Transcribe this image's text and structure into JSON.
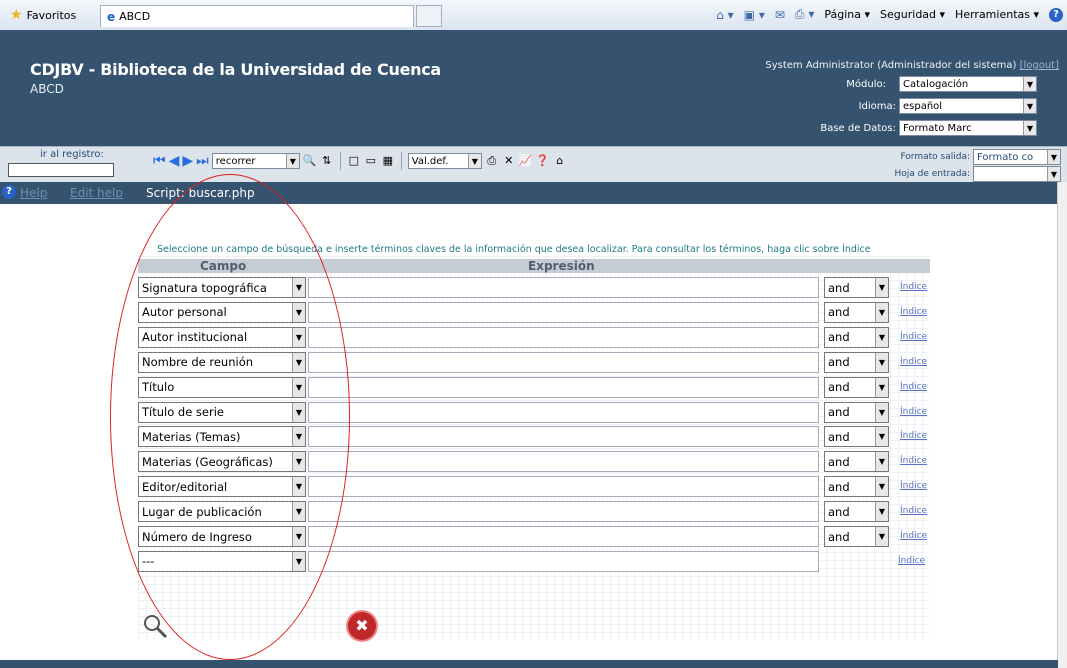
{
  "browser": {
    "favorites_label": "Favoritos",
    "tab_title": "ABCD",
    "commands": [
      "Página ▾",
      "Seguridad ▾",
      "Herramientas ▾"
    ]
  },
  "header": {
    "title": "CDJBV - Biblioteca de la Universidad de Cuenca",
    "subtitle": "ABCD",
    "user_text": "System Administrator (Administrador del sistema)",
    "logout_label": "[logout]",
    "modulo_label": "Módulo:",
    "modulo_value": "Catalogación",
    "idioma_label": "Idioma:",
    "idioma_value": "español",
    "base_label": "Base de Datos:",
    "base_value": "Formato Marc"
  },
  "toolbar": {
    "goto_label": "ir al registro:",
    "browse_value": "recorrer",
    "valdef_value": "Val.def.",
    "formato_label": "Formato salida:",
    "formato_value": "Formato co",
    "hoja_label": "Hoja de entrada:",
    "hoja_value": ""
  },
  "helpbar": {
    "help_label": "Help",
    "edit_help_label": "Edit help",
    "script_text": "Script: buscar.php"
  },
  "search": {
    "instructions": "Seleccione un campo de búsqueda e inserte términos claves de la información que desea localizar. Para consultar los términos, haga clic sobre Índice",
    "col_campo": "Campo",
    "col_expresion": "Expresión",
    "index_label": "Índice",
    "rows": [
      {
        "campo": "Signatura topográfica",
        "op": "and"
      },
      {
        "campo": "Autor personal",
        "op": "and"
      },
      {
        "campo": "Autor institucional",
        "op": "and"
      },
      {
        "campo": "Nombre de reunión",
        "op": "and"
      },
      {
        "campo": "Título",
        "op": "and"
      },
      {
        "campo": "Título de serie",
        "op": "and"
      },
      {
        "campo": "Materias (Temas)",
        "op": "and"
      },
      {
        "campo": "Materias (Geográficas)",
        "op": "and"
      },
      {
        "campo": "Editor/editorial",
        "op": "and"
      },
      {
        "campo": "Lugar de publicación",
        "op": "and"
      },
      {
        "campo": "Número de Ingreso",
        "op": "and"
      },
      {
        "campo": "---",
        "op": ""
      }
    ]
  },
  "colors": {
    "header_bg": "#35536f",
    "link": "#5872c4",
    "intro_text": "#1f7a86",
    "annotation": "#e02020"
  }
}
